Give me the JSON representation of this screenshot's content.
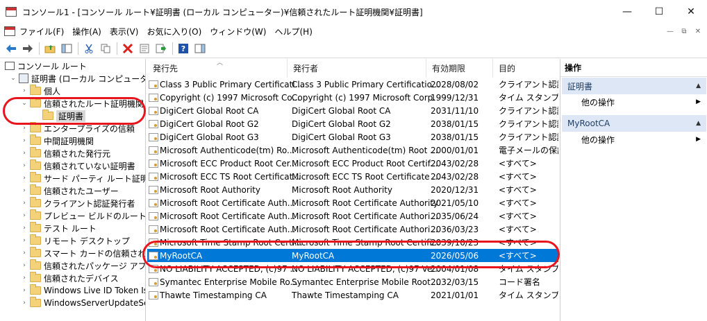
{
  "window": {
    "title": "コンソール1 - [コンソール ルート¥証明書 (ローカル コンピューター)¥信頼されたルート証明機関¥証明書]",
    "minimize": "—",
    "maximize": "☐",
    "close": "✕"
  },
  "menu": {
    "items": [
      "ファイル(F)",
      "操作(A)",
      "表示(V)",
      "お気に入り(O)",
      "ウィンドウ(W)",
      "ヘルプ(H)"
    ],
    "mdi": [
      "—",
      "⧉",
      "✕"
    ]
  },
  "toolbar": {
    "icons": [
      "back-arrow-icon",
      "forward-arrow-icon",
      "up-folder-icon",
      "show-hide-tree-icon",
      "cut-icon",
      "copy-icon",
      "delete-icon",
      "properties-icon",
      "export-icon",
      "help-icon",
      "action-pane-icon"
    ]
  },
  "tree": {
    "items": [
      {
        "label": "コンソール ルート",
        "depth": 0,
        "icon": "console-root-icon",
        "toggle": ""
      },
      {
        "label": "証明書 (ローカル コンピューター)",
        "depth": 1,
        "icon": "certificates-icon",
        "toggle": "v"
      },
      {
        "label": "個人",
        "depth": 2,
        "icon": "folder-icon",
        "toggle": ">"
      },
      {
        "label": "信頼されたルート証明機関",
        "depth": 2,
        "icon": "folder-icon",
        "toggle": "v"
      },
      {
        "label": "証明書",
        "depth": 3,
        "icon": "folder-icon",
        "toggle": "",
        "selected": true
      },
      {
        "label": "エンタープライズの信頼",
        "depth": 2,
        "icon": "folder-icon",
        "toggle": ">"
      },
      {
        "label": "中間証明機関",
        "depth": 2,
        "icon": "folder-icon",
        "toggle": ">"
      },
      {
        "label": "信頼された発行元",
        "depth": 2,
        "icon": "folder-icon",
        "toggle": ">"
      },
      {
        "label": "信頼されていない証明書",
        "depth": 2,
        "icon": "folder-icon",
        "toggle": ">"
      },
      {
        "label": "サード パーティ ルート証明機関",
        "depth": 2,
        "icon": "folder-icon",
        "toggle": ">"
      },
      {
        "label": "信頼されたユーザー",
        "depth": 2,
        "icon": "folder-icon",
        "toggle": ">"
      },
      {
        "label": "クライアント認証発行者",
        "depth": 2,
        "icon": "folder-icon",
        "toggle": ">"
      },
      {
        "label": "プレビュー ビルドのルート",
        "depth": 2,
        "icon": "folder-icon",
        "toggle": ">"
      },
      {
        "label": "テスト ルート",
        "depth": 2,
        "icon": "folder-icon",
        "toggle": ">"
      },
      {
        "label": "リモート デスクトップ",
        "depth": 2,
        "icon": "folder-icon",
        "toggle": ">"
      },
      {
        "label": "スマート カードの信頼されたルート",
        "depth": 2,
        "icon": "folder-icon",
        "toggle": ">"
      },
      {
        "label": "信頼されたパッケージ アプリのインストール",
        "depth": 2,
        "icon": "folder-icon",
        "toggle": ">"
      },
      {
        "label": "信頼されたデバイス",
        "depth": 2,
        "icon": "folder-icon",
        "toggle": ">"
      },
      {
        "label": "Windows Live ID Token Issuer",
        "depth": 2,
        "icon": "folder-icon",
        "toggle": ">"
      },
      {
        "label": "WindowsServerUpdateServices",
        "depth": 2,
        "icon": "folder-icon",
        "toggle": ">"
      }
    ]
  },
  "list": {
    "columns": [
      "発行先",
      "発行者",
      "有効期限",
      "目的"
    ],
    "rows": [
      [
        "Class 3 Public Primary Certificati...",
        "Class 3 Public Primary Certificatio...",
        "2028/08/02",
        "クライアント認証,"
      ],
      [
        "Copyright (c) 1997 Microsoft Co...",
        "Copyright (c) 1997 Microsoft Corp.",
        "1999/12/31",
        "タイム スタンプ"
      ],
      [
        "DigiCert Global Root CA",
        "DigiCert Global Root CA",
        "2031/11/10",
        "クライアント認証,"
      ],
      [
        "DigiCert Global Root G2",
        "DigiCert Global Root G2",
        "2038/01/15",
        "クライアント認証,"
      ],
      [
        "DigiCert Global Root G3",
        "DigiCert Global Root G3",
        "2038/01/15",
        "クライアント認証,"
      ],
      [
        "Microsoft Authenticode(tm) Ro...",
        "Microsoft Authenticode(tm) Root ...",
        "2000/01/01",
        "電子メールの保護"
      ],
      [
        "Microsoft ECC Product Root Cer...",
        "Microsoft ECC Product Root Certif...",
        "2043/02/28",
        "<すべて>"
      ],
      [
        "Microsoft ECC TS Root Certificat...",
        "Microsoft ECC TS Root Certificate ...",
        "2043/02/28",
        "<すべて>"
      ],
      [
        "Microsoft Root Authority",
        "Microsoft Root Authority",
        "2020/12/31",
        "<すべて>"
      ],
      [
        "Microsoft Root Certificate Auth...",
        "Microsoft Root Certificate Authority",
        "2021/05/10",
        "<すべて>"
      ],
      [
        "Microsoft Root Certificate Auth...",
        "Microsoft Root Certificate Authori...",
        "2035/06/24",
        "<すべて>"
      ],
      [
        "Microsoft Root Certificate Auth...",
        "Microsoft Root Certificate Authori...",
        "2036/03/23",
        "<すべて>"
      ],
      [
        "Microsoft Time Stamp Root Certi...",
        "Microsoft Time Stamp Root Certifi...",
        "2039/10/23",
        "<すべて>"
      ],
      [
        "MyRootCA",
        "MyRootCA",
        "2026/05/06",
        "<すべて>"
      ],
      [
        "NO LIABILITY ACCEPTED, (c)97 ...",
        "NO LIABILITY ACCEPTED, (c)97 Ve...",
        "2004/01/08",
        "タイム スタンプ"
      ],
      [
        "Symantec Enterprise Mobile Ro...",
        "Symantec Enterprise Mobile Root ...",
        "2032/03/15",
        "コード署名"
      ],
      [
        "Thawte Timestamping CA",
        "Thawte Timestamping CA",
        "2021/01/01",
        "タイム スタンプ"
      ]
    ],
    "selected_index": 13
  },
  "actions": {
    "title": "操作",
    "sections": [
      {
        "label": "証明書",
        "item": "他の操作"
      },
      {
        "label": "MyRootCA",
        "item": "他の操作"
      }
    ]
  },
  "colors": {
    "selection": "#0078d7",
    "action_section_bg": "#dde7f5",
    "annotation": "#e8141e"
  }
}
